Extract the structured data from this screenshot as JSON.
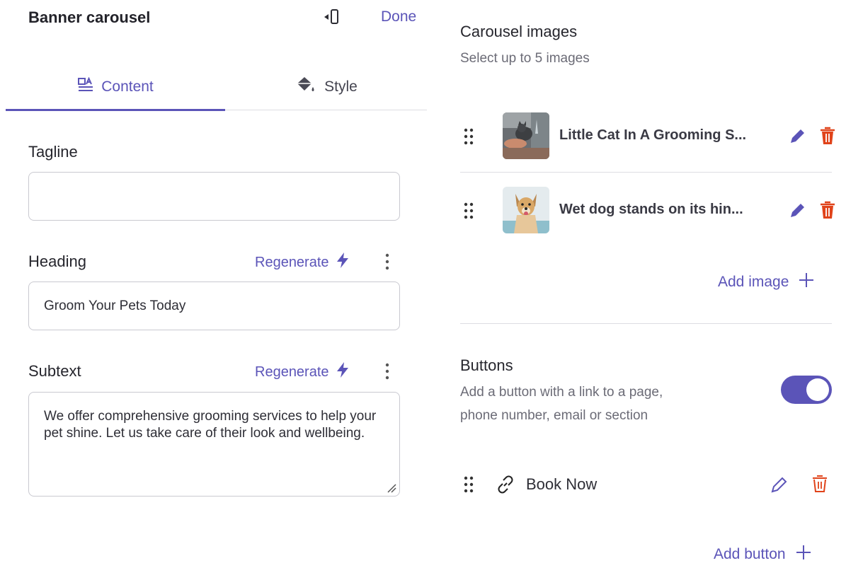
{
  "header": {
    "title": "Banner carousel",
    "done_label": "Done",
    "preview_icon": "mobile-preview-icon"
  },
  "tabs": [
    {
      "label": "Content",
      "icon": "content-icon",
      "active": true
    },
    {
      "label": "Style",
      "icon": "paint-bucket-icon",
      "active": false
    }
  ],
  "fields": {
    "tagline": {
      "label": "Tagline",
      "value": ""
    },
    "heading": {
      "label": "Heading",
      "value": "Groom Your Pets Today",
      "regenerate_label": "Regenerate"
    },
    "subtext": {
      "label": "Subtext",
      "value": "We offer comprehensive grooming services to help your pet shine. Let us take care of their look and wellbeing.",
      "regenerate_label": "Regenerate"
    }
  },
  "carousel": {
    "title": "Carousel images",
    "subtitle": "Select up to 5 images",
    "images": [
      {
        "name": "Little Cat In A Grooming S..."
      },
      {
        "name": "Wet dog stands on its hin..."
      }
    ],
    "add_label": "Add image"
  },
  "buttons": {
    "title": "Buttons",
    "description_line1": "Add a button with a link to a page,",
    "description_line2": "phone number, email or section",
    "enabled": true,
    "items": [
      {
        "label": "Book Now"
      }
    ],
    "add_label": "Add button"
  },
  "colors": {
    "accent": "#5b54b8",
    "danger": "#e0431a"
  }
}
